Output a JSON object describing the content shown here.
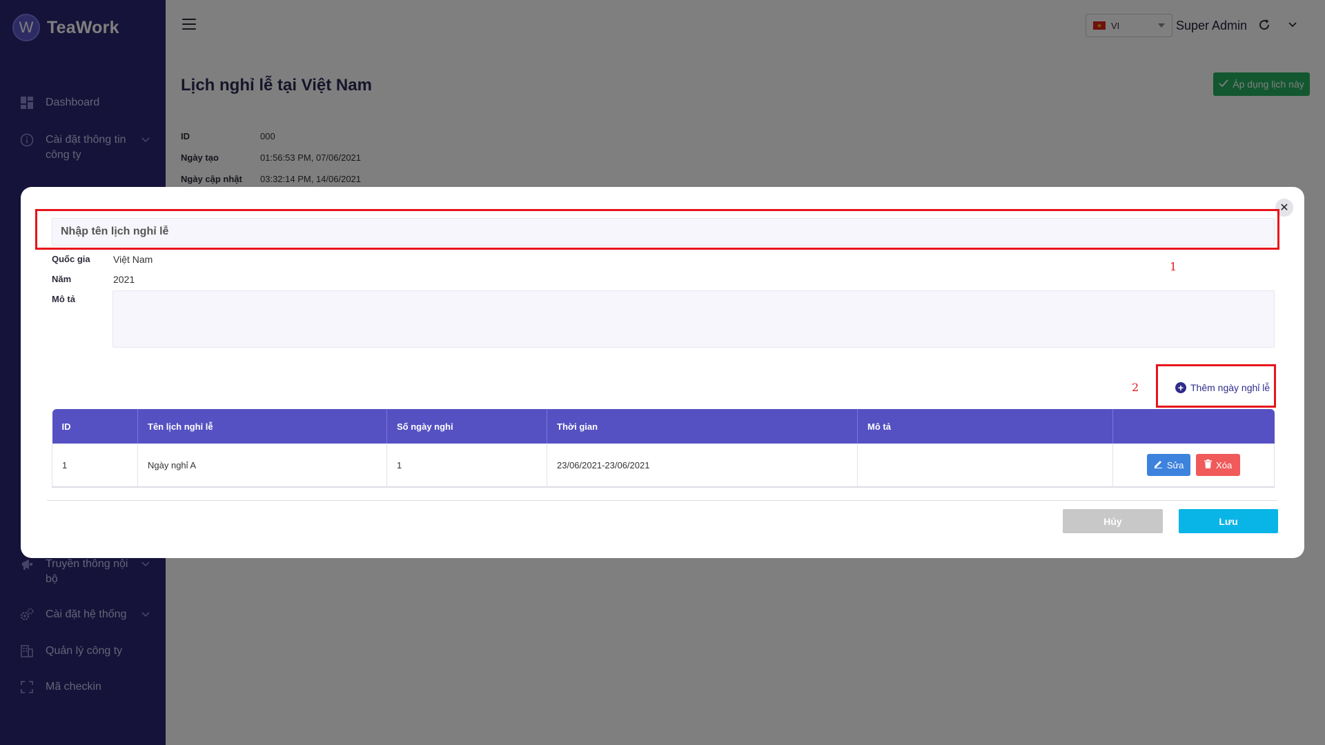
{
  "brand": {
    "logo_letter": "W",
    "name": "TeaWork"
  },
  "sidebar": {
    "items": [
      {
        "label": "Dashboard",
        "icon": "dashboard-icon"
      },
      {
        "label": "Cài đặt thông tin công ty",
        "icon": "info-icon",
        "expandable": true
      },
      {
        "label": "Truyền thông nội bộ",
        "icon": "megaphone-icon",
        "expandable": true
      },
      {
        "label": "Cài đặt hệ thống",
        "icon": "gears-icon",
        "expandable": true
      },
      {
        "label": "Quản lý công ty",
        "icon": "building-icon"
      },
      {
        "label": "Mã checkin",
        "icon": "scan-frame-icon"
      }
    ]
  },
  "topbar": {
    "language": "VI",
    "user_name": "Super Admin"
  },
  "page": {
    "title": "Lịch nghỉ lễ tại Việt Nam",
    "apply_button": "Áp dụng lịch này",
    "info": [
      {
        "key": "ID",
        "value": "000"
      },
      {
        "key": "Ngày tạo",
        "value": "01:56:53 PM, 07/06/2021"
      },
      {
        "key": "Ngày cập nhật",
        "value": "03:32:14 PM, 14/06/2021"
      }
    ]
  },
  "modal": {
    "name_placeholder": "Nhập tên lịch nghỉ lễ",
    "fields": {
      "country_label": "Quốc gia",
      "country_value": "Việt Nam",
      "year_label": "Năm",
      "year_value": "2021",
      "desc_label": "Mô tả"
    },
    "add_holiday": "Thêm ngày nghỉ lễ",
    "table": {
      "headers": [
        "ID",
        "Tên lịch nghỉ lễ",
        "Số ngày nghỉ",
        "Thời gian",
        "Mô tả",
        ""
      ],
      "rows": [
        {
          "id": "1",
          "name": "Ngày nghỉ A",
          "days": "1",
          "time": "23/06/2021-23/06/2021",
          "desc": ""
        }
      ],
      "edit_label": "Sửa",
      "delete_label": "Xóa"
    },
    "cancel_label": "Hủy",
    "save_label": "Lưu",
    "annotations": [
      "1",
      "2"
    ]
  },
  "colors": {
    "sidebar_bg": "#2a2772",
    "header_purple": "#5551c2",
    "apply_green": "#27ae60",
    "save_cyan": "#09b5e6",
    "edit_blue": "#3d82dd",
    "delete_red": "#f05a5a",
    "annotation_red": "#e8121b"
  }
}
